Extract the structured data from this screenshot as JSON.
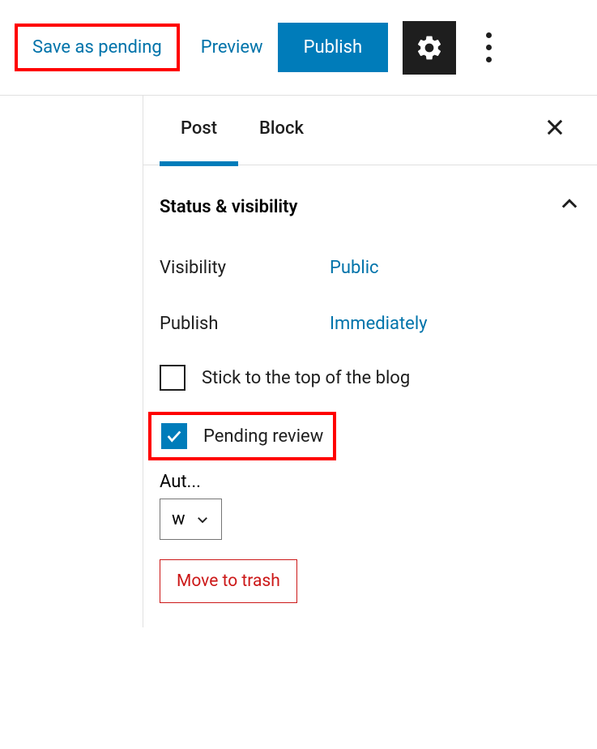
{
  "toolbar": {
    "save_pending_label": "Save as pending",
    "preview_label": "Preview",
    "publish_label": "Publish"
  },
  "sidebar": {
    "tabs": {
      "post": "Post",
      "block": "Block"
    },
    "panel": {
      "title": "Status & visibility",
      "visibility": {
        "label": "Visibility",
        "value": "Public"
      },
      "publish": {
        "label": "Publish",
        "value": "Immediately"
      },
      "stick_top": {
        "label": "Stick to the top of the blog",
        "checked": false
      },
      "pending_review": {
        "label": "Pending review",
        "checked": true
      },
      "author": {
        "label": "Aut...",
        "value": "w"
      },
      "trash_label": "Move to trash"
    }
  }
}
